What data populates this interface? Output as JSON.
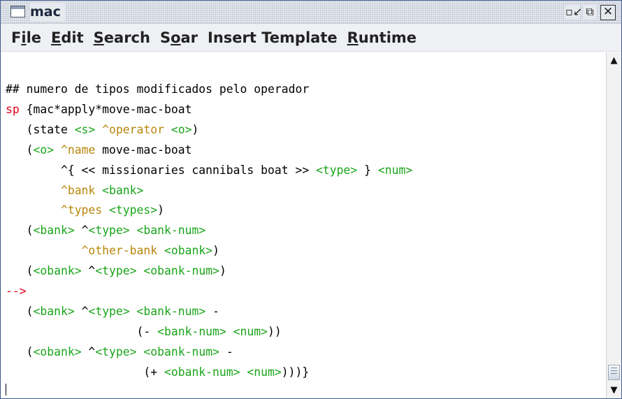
{
  "window": {
    "title": "mac",
    "icons": [
      "document-icon",
      "iconify-icon",
      "maximize-icon",
      "close-icon"
    ],
    "min_glyph": "▫↙",
    "max_glyph": "⧉",
    "close_glyph": "✕"
  },
  "menubar": {
    "items": [
      {
        "pre": "F",
        "key": "i",
        "post": "le"
      },
      {
        "pre": "",
        "key": "E",
        "post": "dit"
      },
      {
        "pre": "",
        "key": "S",
        "post": "earch"
      },
      {
        "pre": "S",
        "key": "o",
        "post": "ar"
      },
      {
        "pre": "Insert Template",
        "key": "",
        "post": ""
      },
      {
        "pre": "",
        "key": "R",
        "post": "untime"
      }
    ]
  },
  "editor": {
    "lines": [
      "## numero de tipos modificados pelo operador",
      "sp {mac*apply*move-mac-boat",
      "   (state <s> ^operator <o>)",
      "   (<o> ^name move-mac-boat",
      "        ^{ << missionaries cannibals boat >> <type> } <num>",
      "        ^bank <bank>",
      "        ^types <types>)",
      "   (<bank> ^<type> <bank-num>",
      "           ^other-bank <obank>)",
      "   (<obank> ^<type> <obank-num>)",
      "-->",
      "   (<bank> ^<type> <bank-num> -",
      "                   (- <bank-num> <num>))",
      "   (<obank> ^<type> <obank-num> -",
      "                    (+ <obank-num> <num>)))}"
    ]
  },
  "colors": {
    "keyword": "#e0001b",
    "rule_name": "#1d24c9",
    "variable": "#1aa51a",
    "attribute": "#b8860b",
    "titlebar": "#e6e9ee"
  }
}
